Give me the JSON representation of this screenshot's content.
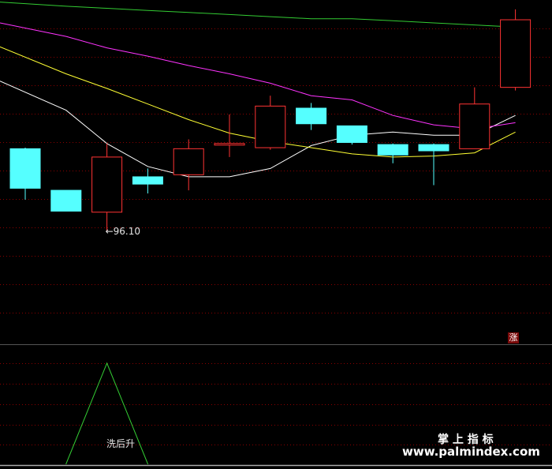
{
  "chart_data": {
    "type": "candlestick",
    "price_axis": {
      "ylim": [
        85.3,
        118.4
      ]
    },
    "candles": [
      {
        "o": 104.1,
        "h": 104.2,
        "l": 99.2,
        "c": 100.3
      },
      {
        "o": 100.1,
        "h": 98.6,
        "l": 98.6,
        "c": 98.1
      },
      {
        "o": 98.0,
        "h": 104.6,
        "l": 96.1,
        "c": 103.3
      },
      {
        "o": 101.4,
        "h": 102.2,
        "l": 99.8,
        "c": 100.7
      },
      {
        "o": 101.6,
        "h": 105.0,
        "l": 100.1,
        "c": 104.1
      },
      {
        "o": 104.5,
        "h": 107.4,
        "l": 103.3,
        "c": 104.6
      },
      {
        "o": 104.2,
        "h": 109.2,
        "l": 104.0,
        "c": 108.2
      },
      {
        "o": 108.0,
        "h": 108.5,
        "l": 105.9,
        "c": 106.5
      },
      {
        "o": 106.3,
        "h": 106.3,
        "l": 104.5,
        "c": 104.7
      },
      {
        "o": 104.5,
        "h": 104.6,
        "l": 102.7,
        "c": 103.5
      },
      {
        "o": 104.5,
        "h": 104.6,
        "l": 100.6,
        "c": 103.9
      },
      {
        "o": 104.1,
        "h": 110.0,
        "l": 104.1,
        "c": 108.4
      },
      {
        "o": 110.0,
        "h": 117.5,
        "l": 109.7,
        "c": 116.5
      }
    ],
    "ma_lines": [
      {
        "color": "#ffffff",
        "values": [
          110.6,
          107.8,
          104.6,
          102.4,
          101.4,
          101.4,
          102.2,
          104.4,
          105.4,
          105.7,
          105.4,
          105.4,
          107.3
        ]
      },
      {
        "color": "#ffff33",
        "values": [
          113.9,
          111.3,
          109.9,
          108.4,
          106.9,
          105.6,
          104.8,
          104.2,
          103.6,
          103.3,
          103.4,
          103.7,
          105.7
        ]
      },
      {
        "color": "#ff33ff",
        "values": [
          116.2,
          114.9,
          113.8,
          113.0,
          112.1,
          111.3,
          110.4,
          109.2,
          108.8,
          107.3,
          106.4,
          106.0,
          106.6
        ]
      },
      {
        "color": "#33cc33",
        "values": [
          118.2,
          117.8,
          117.6,
          117.4,
          117.2,
          117.0,
          116.8,
          116.6,
          116.6,
          116.4,
          116.2,
          116.0,
          115.8
        ]
      }
    ],
    "annotations": {
      "low_marker": "←96.10",
      "rise_tag": "涨",
      "indicator_label": "洗后升"
    },
    "indicator": {
      "values": [
        0,
        0,
        1,
        0,
        0,
        0,
        0,
        0,
        0,
        0,
        0,
        0,
        0
      ],
      "color": "#33cc33"
    },
    "colors": {
      "up": "#ff3333",
      "down": "#55ffff",
      "background": "#000000"
    },
    "grid": true
  },
  "watermark": {
    "title": "掌 上 指 标",
    "url": "www.palmindex.com"
  }
}
